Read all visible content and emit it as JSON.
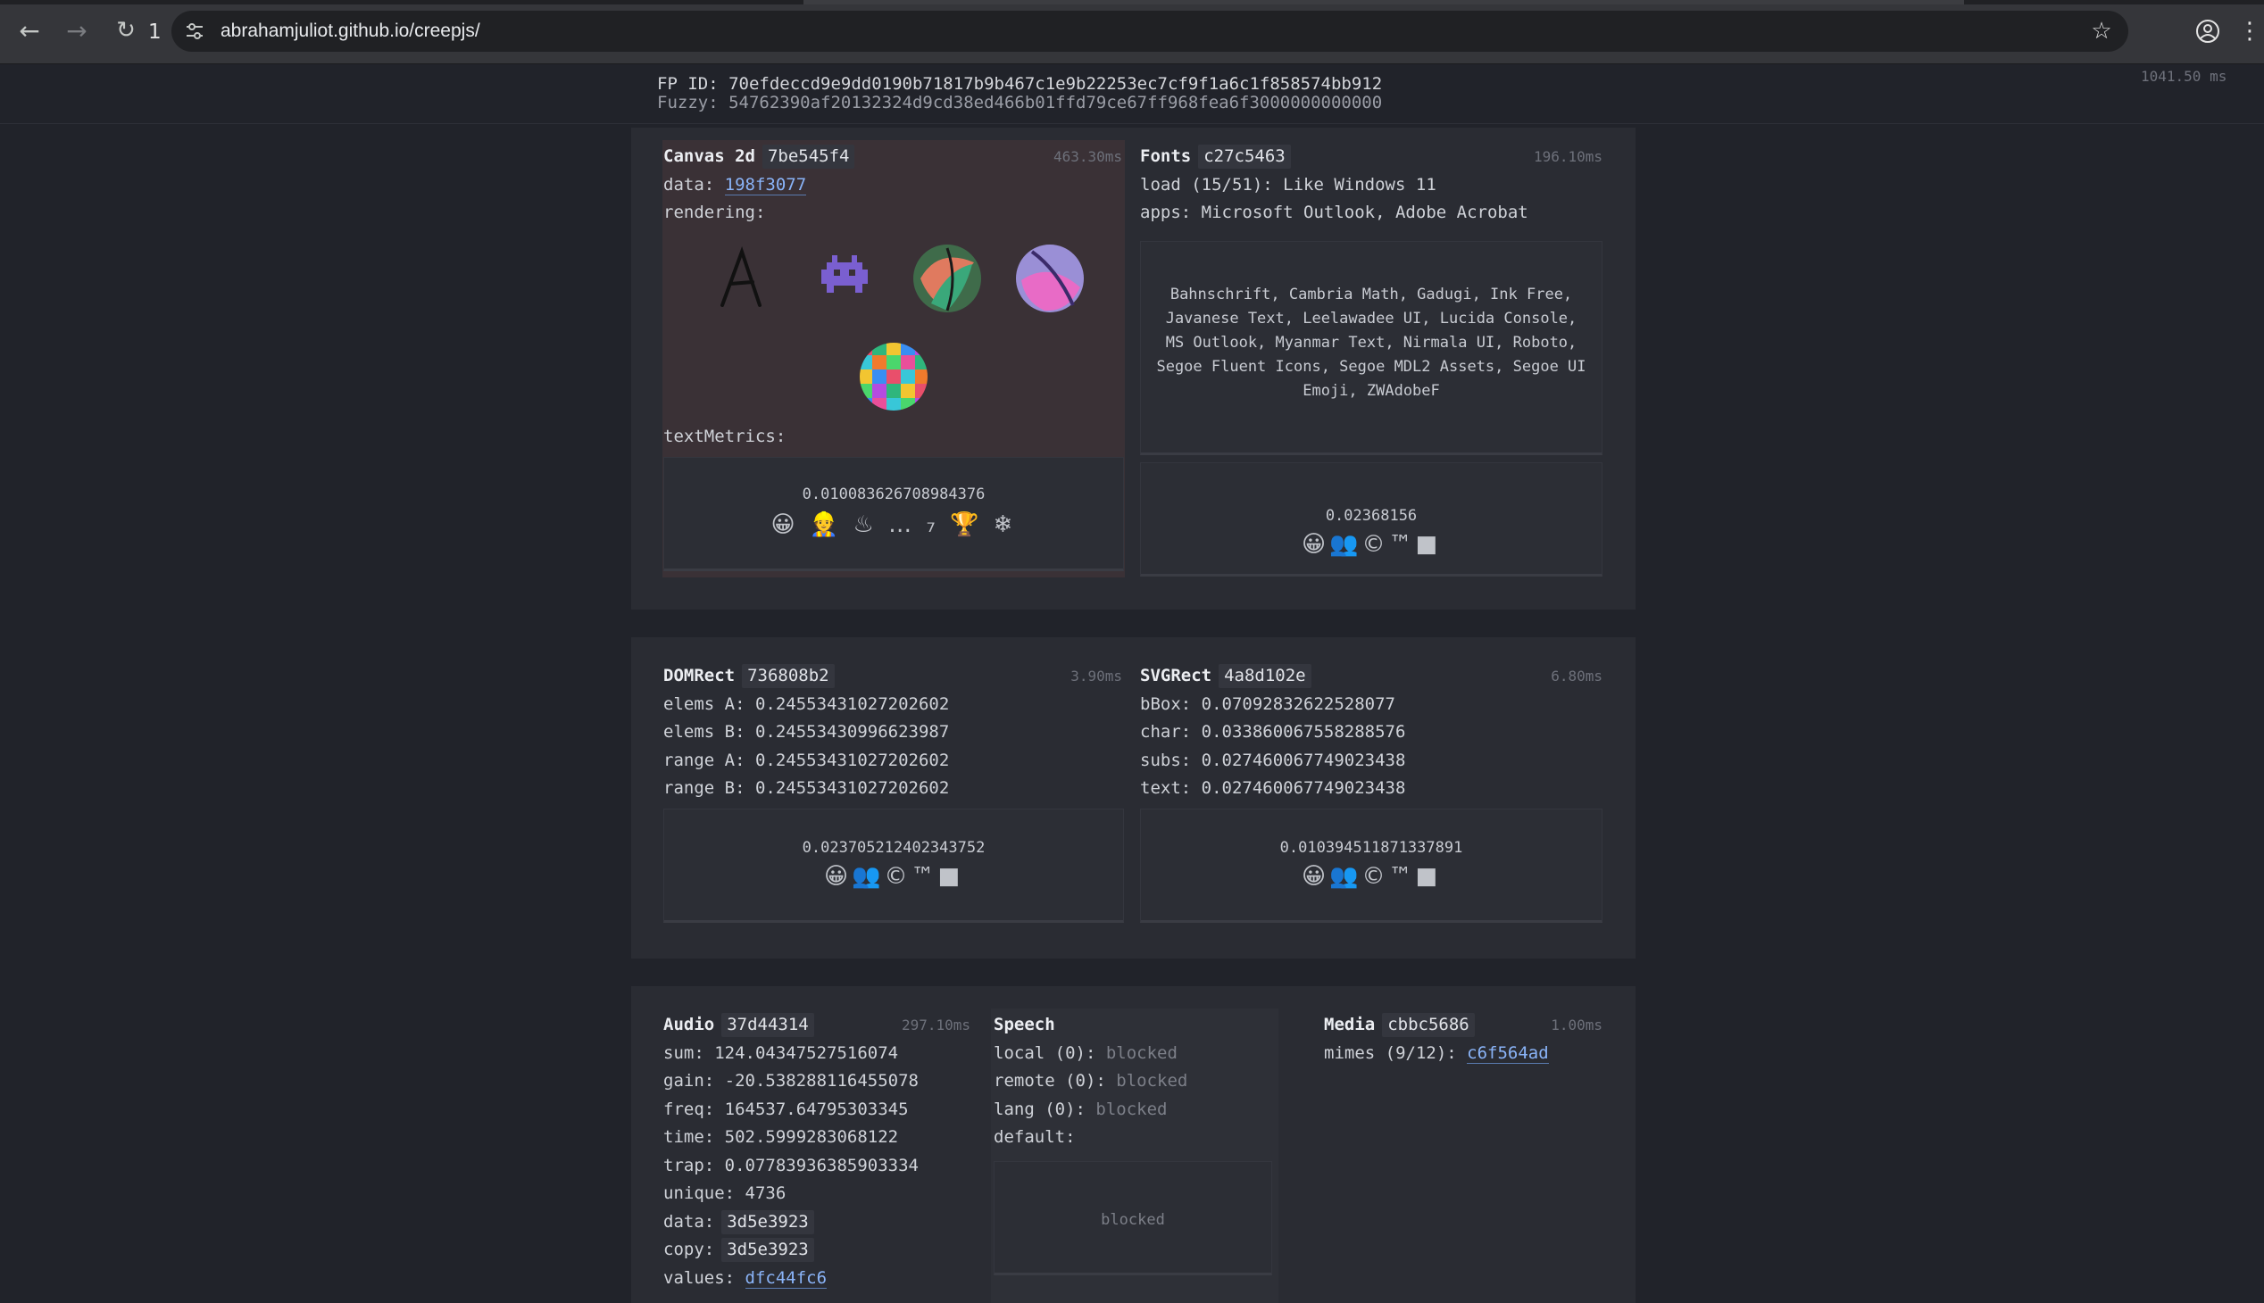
{
  "browser": {
    "tab_count": "1",
    "url": "abrahamjuliot.github.io/creepjs/"
  },
  "header": {
    "fp_id_label": "FP ID:",
    "fp_id": "70efdeccd9e9dd0190b71817b9b467c1e9b22253ec7cf9f1a6c1f858574bb912",
    "fuzzy_label": "Fuzzy:",
    "fuzzy": "54762390af20132324d9cd38ed466b01ffd79ce67ff968fea6f3000000000000",
    "total_time": "1041.50 ms"
  },
  "canvas": {
    "title": "Canvas 2d",
    "hash": "7be545f4",
    "time": "463.30ms",
    "data_label": "data:",
    "data_value": "198f3077",
    "rendering_label": "rendering:",
    "textmetrics_label": "textMetrics:",
    "metric_value": "0.010083626708984376",
    "metric_emojis": "😀 👷 ♨ … ₇ 🏆 ❄"
  },
  "fonts": {
    "title": "Fonts",
    "hash": "c27c5463",
    "time": "196.10ms",
    "load_label": "load (15/51):",
    "load_value": "Like Windows 11",
    "apps_label": "apps:",
    "apps_value": "Microsoft Outlook, Adobe Acrobat",
    "font_list": "Bahnschrift, Cambria Math, Gadugi, Ink Free, Javanese Text, Leelawadee UI, Lucida Console, MS Outlook, Myanmar Text, Nirmala UI, Roboto, Segoe Fluent Icons, Segoe MDL2 Assets, Segoe UI Emoji, ZWAdobeF",
    "metric_value": "0.02368156",
    "metric_emojis": "😀👥©™■"
  },
  "domrect": {
    "title": "DOMRect",
    "hash": "736808b2",
    "time": "3.90ms",
    "rows": [
      {
        "label": "elems A:",
        "value": "0.24553431027202602"
      },
      {
        "label": "elems B:",
        "value": "0.24553430996623987"
      },
      {
        "label": "range A:",
        "value": "0.24553431027202602"
      },
      {
        "label": "range B:",
        "value": "0.24553431027202602"
      }
    ],
    "metric_value": "0.023705212402343752",
    "metric_emojis": "😀👥©™■"
  },
  "svgrect": {
    "title": "SVGRect",
    "hash": "4a8d102e",
    "time": "6.80ms",
    "rows": [
      {
        "label": "bBox:",
        "value": "0.07092832622528077"
      },
      {
        "label": "char:",
        "value": "0.033860067558288576"
      },
      {
        "label": "subs:",
        "value": "0.027460067749023438"
      },
      {
        "label": "text:",
        "value": "0.027460067749023438"
      }
    ],
    "metric_value": "0.010394511871337891",
    "metric_emojis": "😀👥©™■"
  },
  "audio": {
    "title": "Audio",
    "hash": "37d44314",
    "time": "297.10ms",
    "rows": [
      {
        "label": "sum:",
        "value": "124.04347527516074"
      },
      {
        "label": "gain:",
        "value": "-20.538288116455078"
      },
      {
        "label": "freq:",
        "value": "164537.64795303345"
      },
      {
        "label": "time:",
        "value": "502.5999283068122"
      },
      {
        "label": "trap:",
        "value": "0.07783936385903334"
      },
      {
        "label": "unique:",
        "value": "4736"
      }
    ],
    "data_label": "data:",
    "data_value": "3d5e3923",
    "copy_label": "copy:",
    "copy_value": "3d5e3923",
    "values_label": "values:",
    "values_value": "dfc44fc6"
  },
  "speech": {
    "title": "Speech",
    "local_label": "local (0):",
    "remote_label": "remote (0):",
    "lang_label": "lang (0):",
    "status": "blocked",
    "default_label": "default:",
    "default_value": "blocked"
  },
  "media": {
    "title": "Media",
    "hash": "cbbc5686",
    "time": "1.00ms",
    "mimes_label": "mimes (9/12):",
    "mimes_value": "c6f564ad"
  }
}
